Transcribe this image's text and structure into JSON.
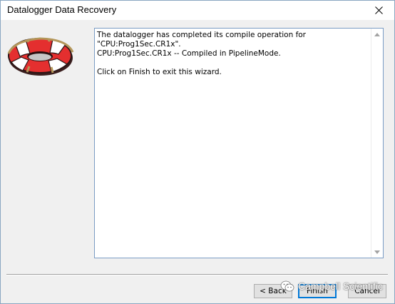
{
  "window": {
    "title": "Datalogger Data Recovery"
  },
  "icons": {
    "close": "close-icon",
    "wizard_image": "lifebuoy-icon",
    "scroll_up": "chevron-up-icon",
    "scroll_down": "chevron-down-icon",
    "watermark_logo": "wechat-icon"
  },
  "message": {
    "text": "The datalogger has completed its compile operation for \"CPU:Prog1Sec.CR1x\".\nCPU:Prog1Sec.CR1x -- Compiled in PipelineMode.\n\nClick on Finish to exit this wizard."
  },
  "buttons": {
    "back": "< Back",
    "finish": "Finish",
    "cancel": "Cancel"
  },
  "watermark": {
    "text": "Campbell Scientific"
  },
  "colors": {
    "lifebuoy_red": "#e42f2f",
    "lifebuoy_white": "#ffffff",
    "rope": "#b4975a",
    "accent_border": "#0078d7"
  }
}
